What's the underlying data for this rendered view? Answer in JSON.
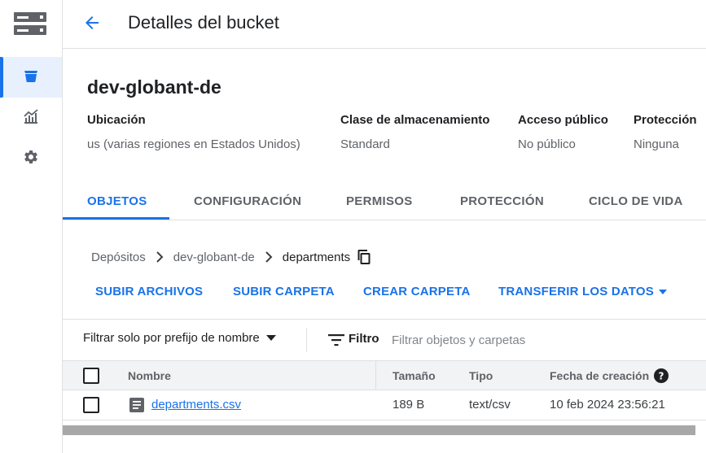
{
  "header": {
    "title": "Detalles del bucket"
  },
  "bucket": {
    "name": "dev-globant-de",
    "info": [
      {
        "label": "Ubicación",
        "value": "us (varias regiones en Estados Unidos)"
      },
      {
        "label": "Clase de almacenamiento",
        "value": "Standard"
      },
      {
        "label": "Acceso público",
        "value": "No público"
      },
      {
        "label": "Protección",
        "value": "Ninguna"
      }
    ]
  },
  "tabs": [
    {
      "label": "OBJETOS"
    },
    {
      "label": "CONFIGURACIÓN"
    },
    {
      "label": "PERMISOS"
    },
    {
      "label": "PROTECCIÓN"
    },
    {
      "label": "CICLO DE VIDA"
    }
  ],
  "breadcrumb": [
    "Depósitos",
    "dev-globant-de",
    "departments"
  ],
  "actions": {
    "upload_files": "SUBIR ARCHIVOS",
    "upload_folder": "SUBIR CARPETA",
    "create_folder": "CREAR CARPETA",
    "transfer_data": "TRANSFERIR LOS DATOS"
  },
  "filter": {
    "prefix_label": "Filtrar solo por prefijo de nombre",
    "filter_label": "Filtro",
    "placeholder": "Filtrar objetos y carpetas"
  },
  "table": {
    "columns": [
      "Nombre",
      "Tamaño",
      "Tipo",
      "Fecha de creación"
    ],
    "rows": [
      {
        "name": "departments.csv",
        "size": "189 B",
        "type": "text/csv",
        "created": "10 feb 2024 23:56:21"
      }
    ]
  },
  "colors": {
    "accent": "#1a73e8",
    "text": "#202124",
    "muted": "#5f6368",
    "header_bg": "#f1f3f4"
  },
  "icons": [
    "storage-logo-icon",
    "bucket-icon",
    "monitoring-icon",
    "settings-icon",
    "back-arrow-icon",
    "chevron-right-icon",
    "copy-icon",
    "dropdown-arrow-icon",
    "filter-icon",
    "help-icon",
    "file-icon"
  ]
}
